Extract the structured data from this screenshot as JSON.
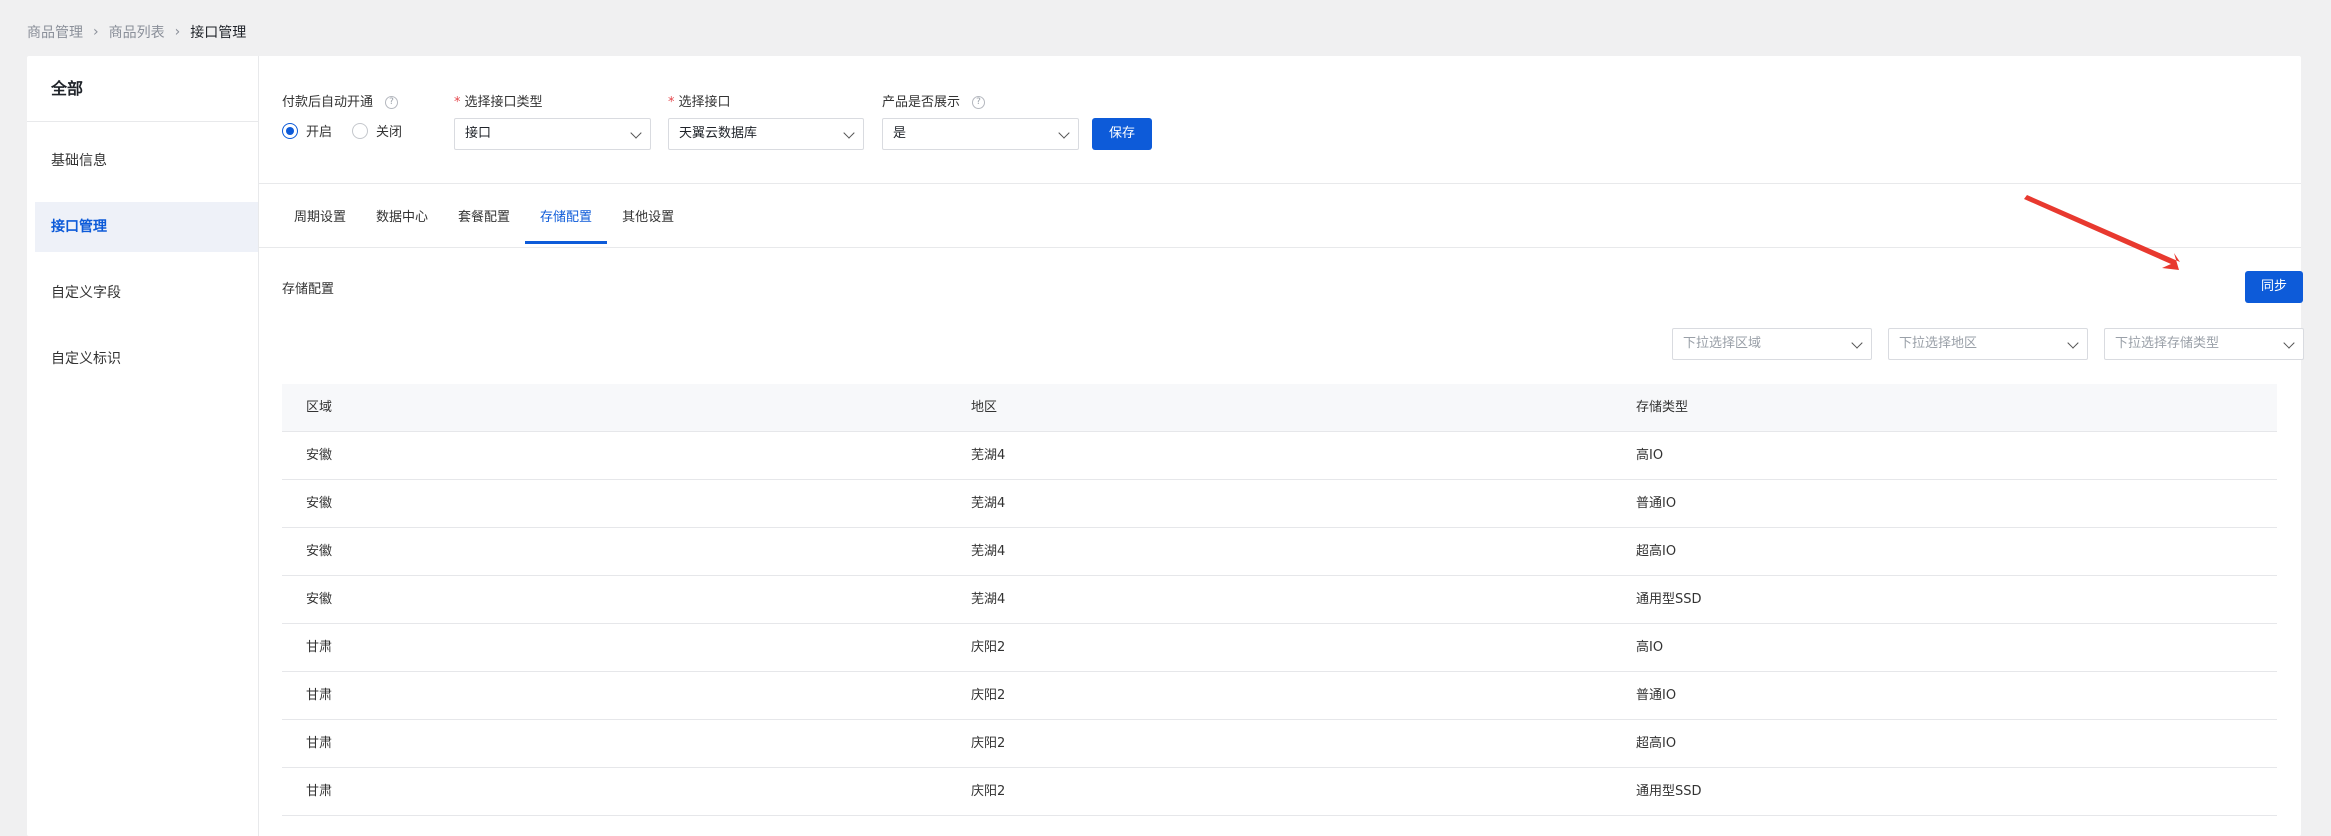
{
  "breadcrumb": [
    "商品管理",
    "商品列表",
    "接口管理"
  ],
  "sidebar": {
    "title": "全部",
    "items": [
      {
        "label": "基础信息",
        "active": false
      },
      {
        "label": "接口管理",
        "active": true
      },
      {
        "label": "自定义字段",
        "active": false
      },
      {
        "label": "自定义标识",
        "active": false
      }
    ]
  },
  "form": {
    "auto_open": {
      "label": "付款后自动开通",
      "options": [
        "开启",
        "关闭"
      ],
      "selected": "开启"
    },
    "interface_type": {
      "label": "选择接口类型",
      "value": "接口"
    },
    "interface": {
      "label": "选择接口",
      "value": "天翼云数据库"
    },
    "display": {
      "label": "产品是否展示",
      "value": "是"
    },
    "save_label": "保存"
  },
  "tabs": [
    {
      "label": "周期设置",
      "active": false
    },
    {
      "label": "数据中心",
      "active": false
    },
    {
      "label": "套餐配置",
      "active": false
    },
    {
      "label": "存储配置",
      "active": true
    },
    {
      "label": "其他设置",
      "active": false
    }
  ],
  "storage": {
    "title": "存储配置",
    "sync_label": "同步",
    "filters": {
      "region_placeholder": "下拉选择区域",
      "area_placeholder": "下拉选择地区",
      "type_placeholder": "下拉选择存储类型"
    },
    "columns": [
      "区域",
      "地区",
      "存储类型"
    ],
    "rows": [
      [
        "安徽",
        "芜湖4",
        "高IO"
      ],
      [
        "安徽",
        "芜湖4",
        "普通IO"
      ],
      [
        "安徽",
        "芜湖4",
        "超高IO"
      ],
      [
        "安徽",
        "芜湖4",
        "通用型SSD"
      ],
      [
        "甘肃",
        "庆阳2",
        "高IO"
      ],
      [
        "甘肃",
        "庆阳2",
        "普通IO"
      ],
      [
        "甘肃",
        "庆阳2",
        "超高IO"
      ],
      [
        "甘肃",
        "庆阳2",
        "通用型SSD"
      ]
    ]
  },
  "colors": {
    "primary": "#0d5bd9",
    "annotation_arrow": "#e8392f"
  }
}
